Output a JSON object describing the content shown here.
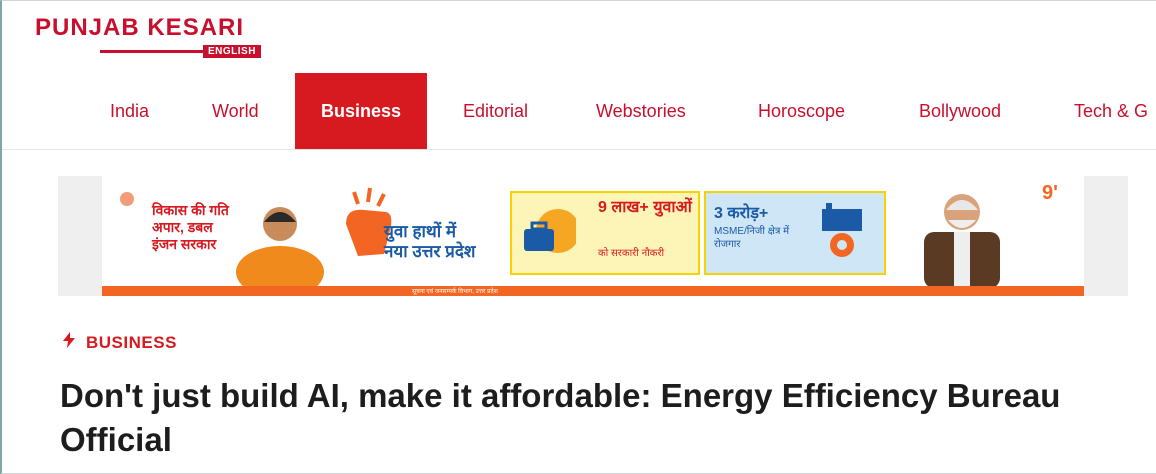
{
  "logo": {
    "title": "PUNJAB KESARI",
    "subtitle": "ENGLISH"
  },
  "nav": {
    "items": [
      "India",
      "World",
      "Business",
      "Editorial",
      "Webstories",
      "Horoscope",
      "Bollywood",
      "Tech & G"
    ],
    "active": "Business"
  },
  "banner": {
    "left_text": "विकास की गति अपार, डबल इंजन सरकार",
    "youth_text_1": "युवा हाथों में",
    "youth_text_2": "नया उत्तर प्रदेश",
    "card1_big": "9 लाख+ युवाओं",
    "card1_small": "को सरकारी नौकरी",
    "card2_big": "3 करोड़+",
    "card2_small": "MSME/निजी क्षेत्र में रोजगार",
    "footer_text": "सूचना एवं जनसम्पर्क विभाग, उत्तर प्रदेश",
    "corner_mark": "9'"
  },
  "article": {
    "category": "BUSINESS",
    "headline": "Don't just build AI, make it affordable: Energy Efficiency Bureau Official"
  },
  "colors": {
    "brand_red": "#d71920",
    "banner_orange": "#f26522",
    "banner_blue": "#cfe6f7",
    "banner_yellow": "#fdf5b8"
  }
}
